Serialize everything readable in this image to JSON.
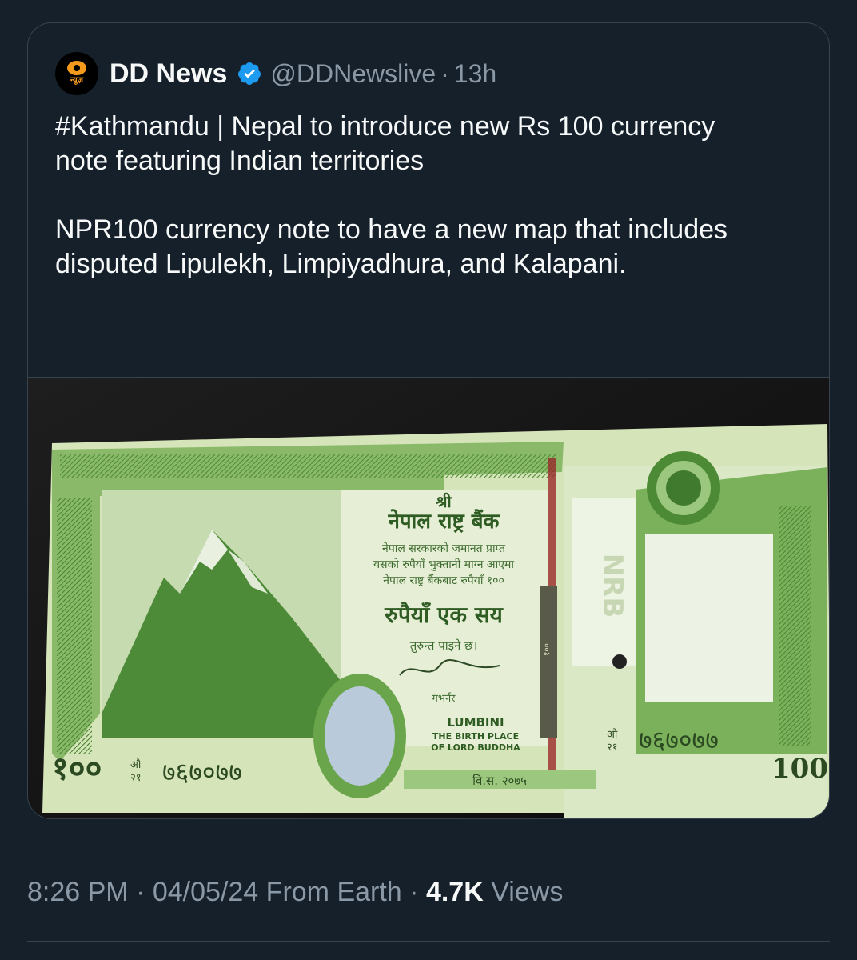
{
  "quoted_tweet": {
    "author_name": "DD News",
    "avatar_label": "न्यूज़",
    "handle": "@DDNewslive",
    "separator": "·",
    "time_ago": "13h",
    "text": "#Kathmandu | Nepal to introduce new Rs 100 currency note featuring Indian territories\n\nNPR100 currency note to have a new map that includes disputed Lipulekh, Limpiyadhura, and Kalapani."
  },
  "banknote": {
    "shri": "श्री",
    "bank_name": "नेपाल राष्ट्र बैंक",
    "promise_line1": "नेपाल सरकारको जमानत प्राप्त",
    "promise_line2": "यसको रुपैयाँ भुक्तानी माग्न आएमा",
    "promise_line3": "नेपाल राष्ट्र बैंकबाट रुपैयाँ १००",
    "amount_words": "रुपैयाँ एक सय",
    "payable": "तुरुन्त पाइने छ।",
    "governor": "गभर्नर",
    "lumbini": "LUMBINI",
    "birth_place_line1": "THE BIRTH PLACE",
    "birth_place_line2": "OF LORD BUDDHA",
    "denomination": "१००",
    "denomination_latin": "100",
    "serial": "७६७०७७",
    "prefix_top": "औ",
    "prefix_bottom": "२१",
    "year": "वि.स. २०७५",
    "nrb": "NRB",
    "security_thread": "१००"
  },
  "footer": {
    "time": "8:26 PM",
    "separator": "·",
    "date": "04/05/24",
    "location": "From Earth",
    "views_count": "4.7K",
    "views_label": "Views"
  },
  "colors": {
    "background": "#15202b",
    "border": "#38444d",
    "muted": "#8b98a5",
    "verified": "#1d9bf0",
    "note_green": "#5a9a3e",
    "note_paper": "#dce8c4"
  }
}
